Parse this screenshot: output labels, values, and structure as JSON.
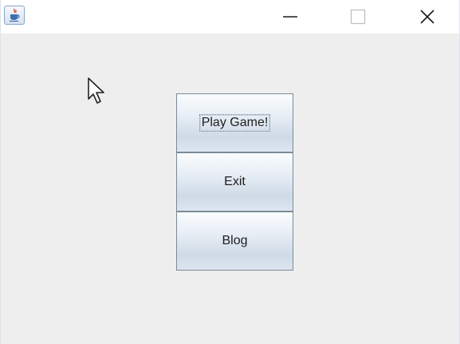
{
  "window": {
    "app_icon": "java-cup-icon",
    "controls": {
      "minimize_icon": "minimize-icon",
      "maximize_icon": "maximize-icon",
      "close_icon": "close-icon"
    }
  },
  "menu": {
    "buttons": [
      {
        "label": "Play Game!",
        "focused": true
      },
      {
        "label": "Exit",
        "focused": false
      },
      {
        "label": "Blog",
        "focused": false
      }
    ]
  },
  "cursor": "mouse-pointer-icon",
  "colors": {
    "background": "#eeeeee",
    "titlebar": "#ffffff",
    "button_border": "#7a8a99",
    "button_gradient_top": "#fbfcfd",
    "button_gradient_mid": "#cfdae6",
    "text": "#1e1e1e"
  }
}
